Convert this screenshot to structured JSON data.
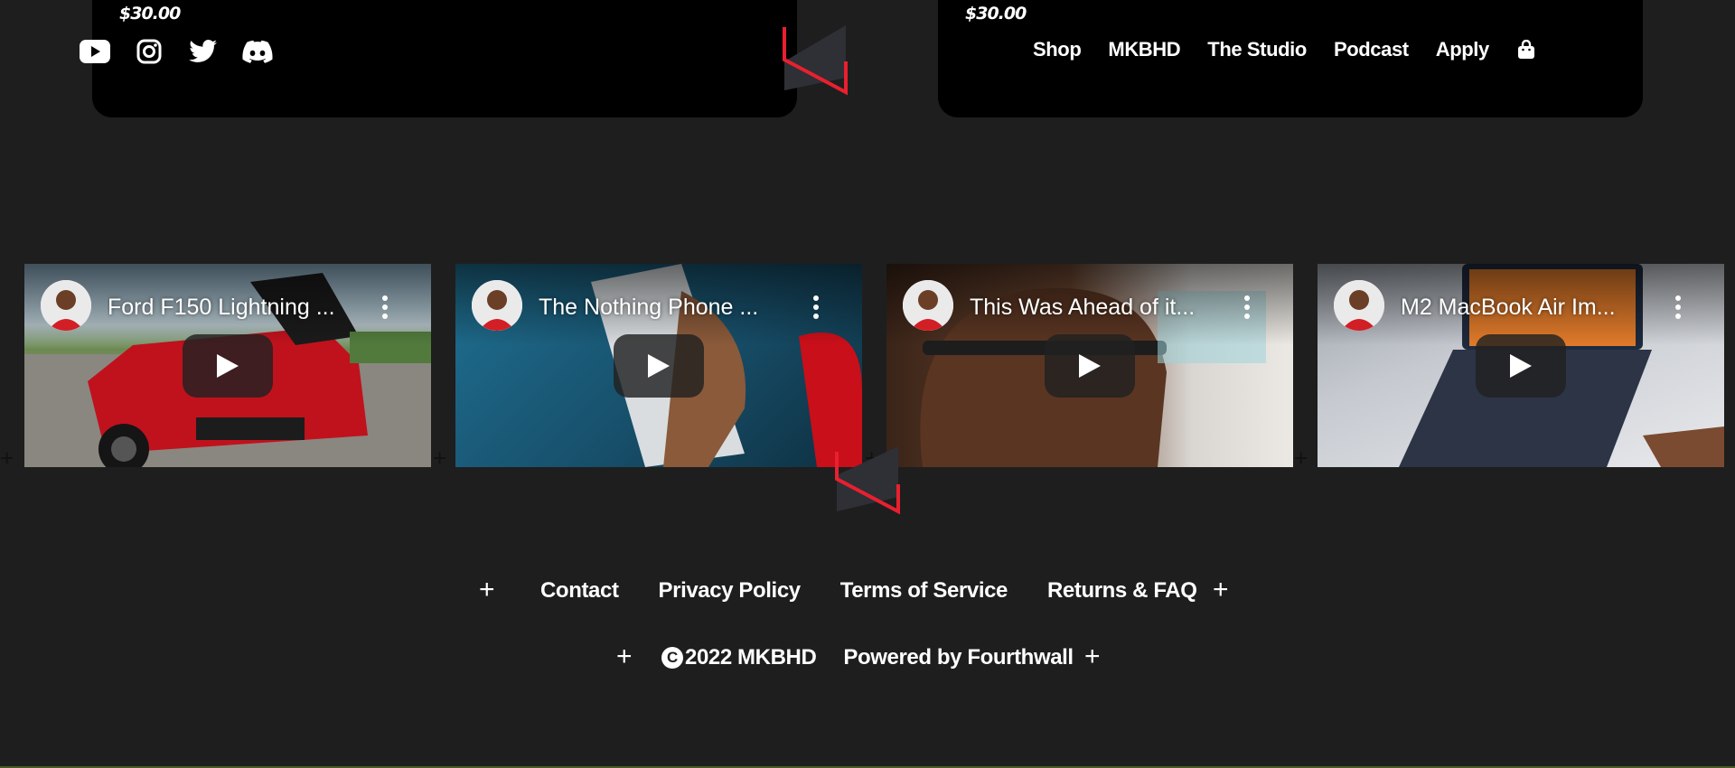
{
  "panels": {
    "left": {
      "price": "$30.00"
    },
    "right": {
      "price": "$30.00"
    }
  },
  "socials": [
    {
      "icon": "youtube-icon"
    },
    {
      "icon": "instagram-icon"
    },
    {
      "icon": "twitter-icon"
    },
    {
      "icon": "discord-icon"
    }
  ],
  "nav": {
    "items": [
      "Shop",
      "MKBHD",
      "The Studio",
      "Podcast",
      "Apply"
    ],
    "cart_icon": "shopping-bag-icon"
  },
  "videos": [
    {
      "title": "Ford F150 Lightning ..."
    },
    {
      "title": "The Nothing Phone ..."
    },
    {
      "title": "This Was Ahead of it..."
    },
    {
      "title": "M2 MacBook Air Im..."
    }
  ],
  "footer": {
    "links": [
      "Contact",
      "Privacy Policy",
      "Terms of Service",
      "Returns & FAQ"
    ],
    "copyright_symbol": "C",
    "copyright": "2022 MKBHD",
    "powered": "Powered by Fourthwall",
    "plus": "+"
  },
  "colors": {
    "accent": "#e8202f",
    "background": "#1e1e1e",
    "panel": "#000000"
  }
}
